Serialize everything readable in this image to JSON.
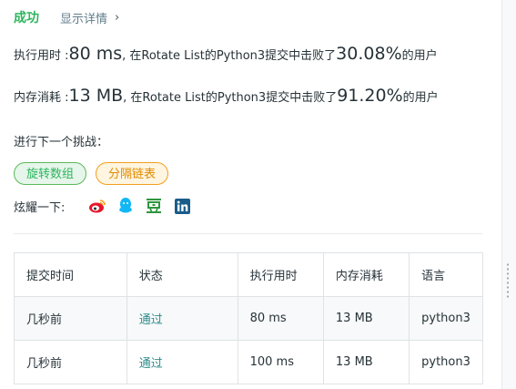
{
  "header": {
    "status": "成功",
    "details_link": "显示详情",
    "chevron": "›"
  },
  "runtime": {
    "label": "执行用时 : ",
    "value": "80 ms",
    "text_mid": ", 在Rotate List的Python3提交中击败了",
    "percent": "30.08%",
    "text_end": " 的用户"
  },
  "memory": {
    "label": "内存消耗 : ",
    "value": "13 MB",
    "text_mid": ", 在Rotate List的Python3提交中击败了",
    "percent": "91.20%",
    "text_end": " 的用户"
  },
  "next_challenge": {
    "label": "进行下一个挑战：",
    "chips": [
      {
        "label": "旋转数组",
        "difficulty": "easy"
      },
      {
        "label": "分隔链表",
        "difficulty": "medium"
      }
    ]
  },
  "share": {
    "label": "炫耀一下:",
    "icons": [
      "weibo-icon",
      "qq-icon",
      "douban-icon",
      "linkedin-icon"
    ]
  },
  "table": {
    "headers": [
      "提交时间",
      "状态",
      "执行用时",
      "内存消耗",
      "语言"
    ],
    "rows": [
      [
        "几秒前",
        "通过",
        "80 ms",
        "13 MB",
        "python3"
      ],
      [
        "几秒前",
        "通过",
        "100 ms",
        "13 MB",
        "python3"
      ]
    ]
  },
  "colors": {
    "success": "#2db55d",
    "easy": "#2db55d",
    "medium": "#e08a00",
    "link": "#2e8b8b"
  }
}
